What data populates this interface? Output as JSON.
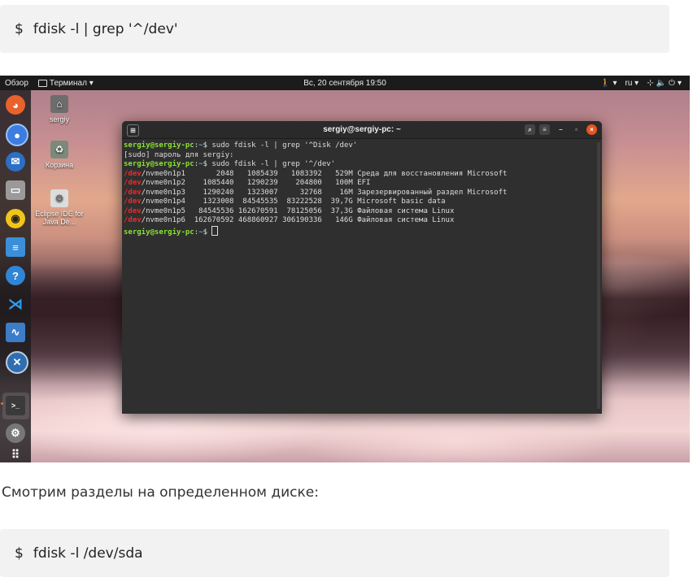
{
  "code_blocks": [
    {
      "prompt": "$",
      "command": "fdisk -l | grep '^/dev'"
    },
    {
      "prompt": "$",
      "command": "fdisk -l /dev/sda"
    }
  ],
  "paragraph": "Смотрим разделы на определенном диске:",
  "topbar": {
    "overview": "Обзор",
    "app_menu": "Терминал ▾",
    "datetime": "Вс, 20 сентября  19:50",
    "lang": "ru ▾",
    "accessibility_arrow": "▾",
    "system_arrow": "▾"
  },
  "desktop_icons": [
    {
      "label": "sergiy"
    },
    {
      "label": "Корзина"
    },
    {
      "label": "Eclipse IDE for Java De..."
    }
  ],
  "dock": [
    {
      "name": "firefox-icon",
      "color": "#e8622b"
    },
    {
      "name": "chromium-icon",
      "color": "#3b7de0"
    },
    {
      "name": "thunderbird-icon",
      "color": "#2c6fc4"
    },
    {
      "name": "files-icon",
      "color": "#9a9a9a"
    },
    {
      "name": "rhythmbox-icon",
      "color": "#f0c419"
    },
    {
      "name": "writer-icon",
      "color": "#3a8fd8"
    },
    {
      "name": "help-icon",
      "color": "#2f86d6"
    },
    {
      "name": "vscode-icon",
      "color": "#1c7ccf"
    },
    {
      "name": "system-monitor-icon",
      "color": "#3c7dc8"
    },
    {
      "name": "xorg-icon",
      "color": "#2f6eb0"
    },
    {
      "name": "terminal-icon",
      "color": "#3a3a3a"
    },
    {
      "name": "settings-icon",
      "color": "#777777"
    },
    {
      "name": "apps-grid-icon",
      "color": "#ffffff"
    }
  ],
  "terminal": {
    "title": "sergiy@sergiy-pc: ~",
    "prompt_user": "sergiy@sergiy-pc",
    "prompt_sep": ":",
    "prompt_path": "~",
    "prompt_end": "$",
    "lines": [
      {
        "kind": "cmd",
        "text": " sudo fdisk -l | grep '^Disk /dev'"
      },
      {
        "kind": "out",
        "text": "[sudo] пароль для sergiy:"
      },
      {
        "kind": "cmd",
        "text": " sudo fdisk -l | grep '^/dev'"
      },
      {
        "kind": "dev",
        "hl": "/dev",
        "text": "/nvme0n1p1       2048   1085439   1083392   529M Среда для восстановления Microsoft"
      },
      {
        "kind": "dev",
        "hl": "/dev",
        "text": "/nvme0n1p2    1085440   1290239    204800   100M EFI"
      },
      {
        "kind": "dev",
        "hl": "/dev",
        "text": "/nvme0n1p3    1290240   1323007     32768    16M Зарезервированный раздел Microsoft"
      },
      {
        "kind": "dev",
        "hl": "/dev",
        "text": "/nvme0n1p4    1323008  84545535  83222528  39,7G Microsoft basic data"
      },
      {
        "kind": "dev",
        "hl": "/dev",
        "text": "/nvme0n1p5   84545536 162670591  78125056  37,3G Файловая система Linux"
      },
      {
        "kind": "dev",
        "hl": "/dev",
        "text": "/nvme0n1p6  162670592 468860927 306190336   146G Файловая система Linux"
      },
      {
        "kind": "cmd",
        "text": " "
      }
    ]
  }
}
